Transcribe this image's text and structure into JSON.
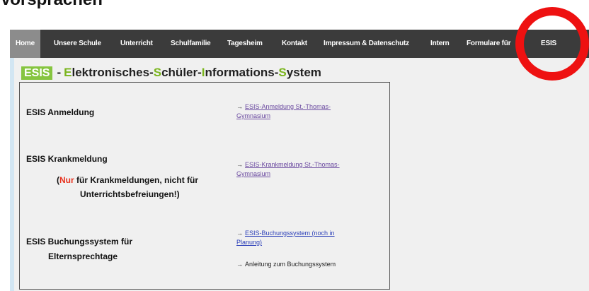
{
  "heading": {
    "text": "Vorsprachen"
  },
  "nav": {
    "items": [
      {
        "label": "Home"
      },
      {
        "label": "Unsere Schule"
      },
      {
        "label": "Unterricht"
      },
      {
        "label": "Schulfamilie"
      },
      {
        "label": "Tagesheim"
      },
      {
        "label": "Kontakt"
      },
      {
        "label": "Impressum & Datenschutz"
      },
      {
        "label": "Intern"
      },
      {
        "label": "Formulare für"
      },
      {
        "label": "ESIS"
      }
    ]
  },
  "title": {
    "badge": "ESIS",
    "dash": "-",
    "parts": [
      {
        "initial": "E",
        "rest": "lektronisches-"
      },
      {
        "initial": "S",
        "rest": "chüler-"
      },
      {
        "initial": "I",
        "rest": "nformations-"
      },
      {
        "initial": "S",
        "rest": "ystem"
      }
    ]
  },
  "sections": {
    "anmeldung": {
      "label": "ESIS Anmeldung",
      "link_line1": "ESIS-Anmeldung St.-Thomas-",
      "link_line2": "Gymnasium"
    },
    "krankmeldung": {
      "label": "ESIS Krankmeldung",
      "note_red": "Nur",
      "note_rest": " für Krankmeldungen, nicht für",
      "note_line2": "Unterrichtsbefreiungen!)",
      "note_open": "(",
      "link_line1": "ESIS-Krankmeldung St.-Thomas-",
      "link_line2": "Gymnasium"
    },
    "buchung": {
      "label_line1": "ESIS Buchungssystem für",
      "label_line2": "Elternsprechtage",
      "link_line1": "ESIS-Buchungssystem (noch in",
      "link_line2": "Planung)",
      "guide": "Anleitung zum Buchungssystem"
    }
  },
  "arrow": "→",
  "colors": {
    "nav_bg": "#3b3b3b",
    "nav_active": "#8c8c8c",
    "badge_green": "#86c540",
    "title_green": "#7ab51d",
    "highlight_red": "#ee1111"
  }
}
